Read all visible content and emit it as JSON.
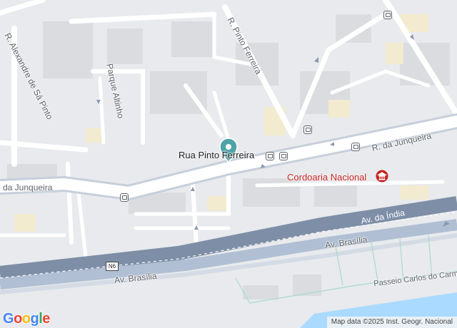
{
  "map": {
    "colors": {
      "background": "#e8eaed",
      "block": "#dadce0",
      "minor_road": "#ffffff",
      "major_road": "#b0bfd3",
      "highway": "#8a9bb0",
      "water": "#aadaff",
      "yellow_area": "#f3ebd0",
      "poi": "#c5221f",
      "pin": "#4fa3a6"
    },
    "streets": {
      "r_pinto_ferreira": "R. Pinto Ferreira",
      "alexandre_sa_pinto": "R. Alexandre de Sá Pinto",
      "parque_altinho": "Parque Altinho",
      "r_junqueira_east": "R. da Junqueira",
      "r_junqueira_west": "da Junqueira",
      "av_india": "Av. da Índia",
      "av_brasilia_upper": "Av. Brasília",
      "av_brasilia_lower": "Av. Brasília",
      "passeio": "Passeio Carlos do Carm"
    },
    "pin": {
      "label": "Rua Pinto Ferreira",
      "icon": "location-pin-icon"
    },
    "poi": {
      "label": "Cordoaria Nacional",
      "icon": "museum-icon"
    },
    "route": "N6",
    "brand": {
      "letters": [
        {
          "ch": "G",
          "color": "#4285F4"
        },
        {
          "ch": "o",
          "color": "#EA4335"
        },
        {
          "ch": "o",
          "color": "#FBBC05"
        },
        {
          "ch": "g",
          "color": "#4285F4"
        },
        {
          "ch": "l",
          "color": "#34A853"
        },
        {
          "ch": "e",
          "color": "#EA4335"
        }
      ]
    },
    "attribution": "Map data ©2025 Inst. Geogr. Nacional"
  }
}
